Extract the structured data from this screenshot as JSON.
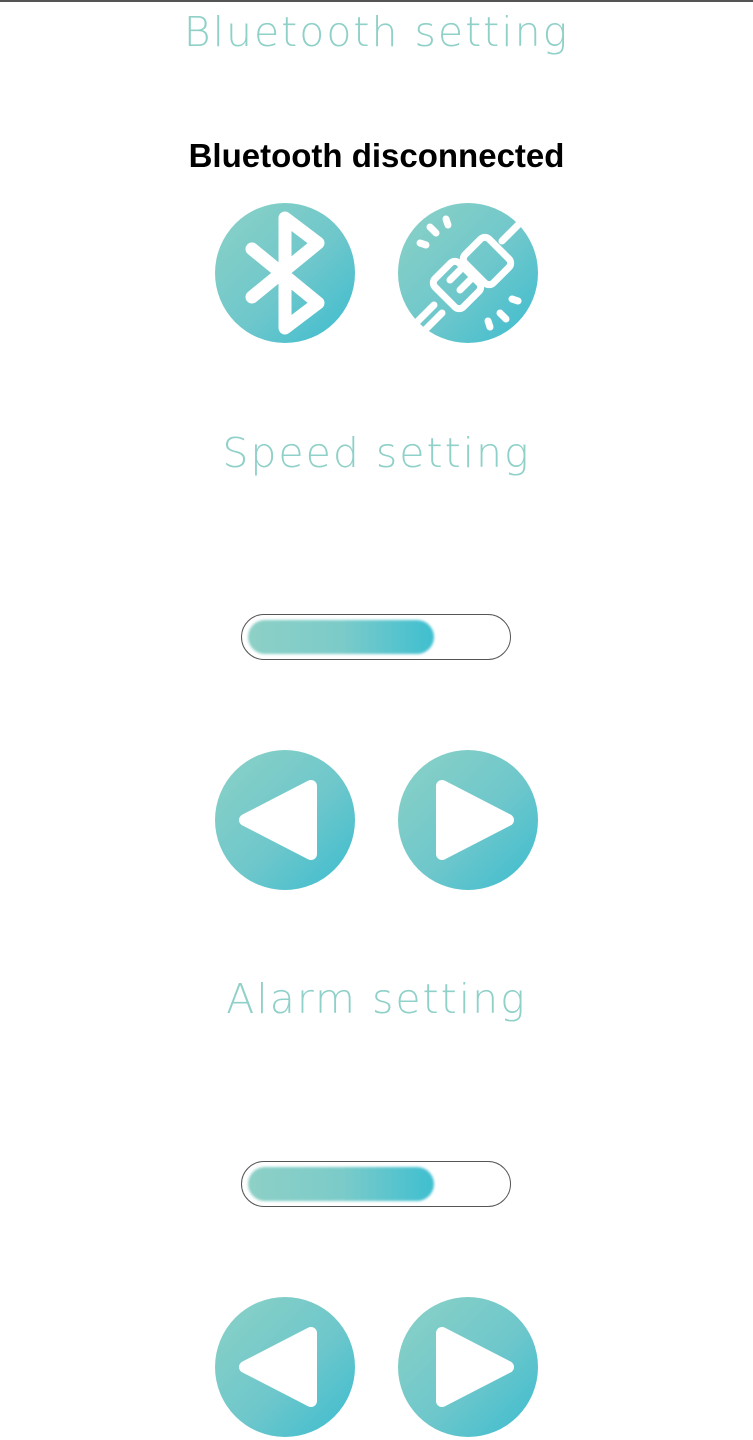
{
  "bluetooth": {
    "title": "Bluetooth setting",
    "status": "Bluetooth disconnected",
    "connect_icon": "bluetooth-icon",
    "disconnect_icon": "unplugged-icon"
  },
  "speed": {
    "title": "Speed setting",
    "level": 0.72,
    "decrease_icon": "triangle-left-icon",
    "increase_icon": "triangle-right-icon"
  },
  "alarm": {
    "title": "Alarm setting",
    "level": 0.72,
    "decrease_icon": "triangle-left-icon",
    "increase_icon": "triangle-right-icon"
  },
  "colors": {
    "accent_light": "#8cd1c6",
    "accent_dark": "#3bbccf",
    "title_text": "#8fd0c8"
  }
}
